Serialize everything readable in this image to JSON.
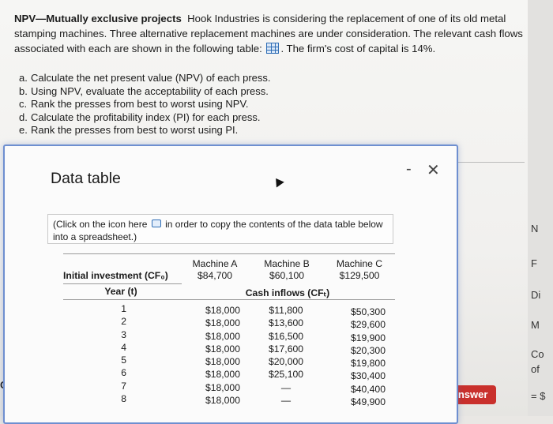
{
  "problem": {
    "title": "NPV—Mutually exclusive projects",
    "line1": "Hook Industries is considering the replacement of one of its old metal",
    "line2": "stamping machines. Three alternative replacement machines are under consideration. The relevant cash flows",
    "line3a": "associated with each are shown in the following table:",
    "line3b": ". The firm's cost of capital is 14%.",
    "tasks": [
      {
        "key": "a.",
        "text": "Calculate the net present value (NPV) of each press."
      },
      {
        "key": "b.",
        "text": "Using NPV, evaluate the acceptability of each press."
      },
      {
        "key": "c.",
        "text": "Rank the presses from best to worst using NPV."
      },
      {
        "key": "d.",
        "text": "Calculate the profitability index (PI) for each press."
      },
      {
        "key": "e.",
        "text": "Rank the presses from best to worst using PI."
      }
    ]
  },
  "modal": {
    "title": "Data table",
    "minimize": "-",
    "close": "✕",
    "note_a": "(Click on the icon here",
    "note_b": "in order to copy the contents of the data table below",
    "note_c": "into a spreadsheet.)"
  },
  "table": {
    "machines": [
      "Machine A",
      "Machine B",
      "Machine C"
    ],
    "initial_label": "Initial investment (CF₀)",
    "initial": [
      "$84,700",
      "$60,100",
      "$129,500"
    ],
    "year_label": "Year (t)",
    "cash_label": "Cash inflows (CFₜ)",
    "years": [
      "1",
      "2",
      "3",
      "4",
      "5",
      "6",
      "7",
      "8"
    ],
    "a": [
      "$18,000",
      "$18,000",
      "$18,000",
      "$18,000",
      "$18,000",
      "$18,000",
      "$18,000",
      "$18,000"
    ],
    "b": [
      "$11,800",
      "$13,600",
      "$16,500",
      "$17,600",
      "$20,000",
      "$25,100",
      "—",
      "—"
    ],
    "c": [
      "$50,300",
      "$29,600",
      "$19,900",
      "$20,300",
      "$19,800",
      "$30,400",
      "$40,400",
      "$49,900"
    ]
  },
  "side": {
    "edge": [
      "N",
      "F",
      "Di",
      "M",
      "Co",
      "of",
      "= $"
    ],
    "answer": "answer",
    "ge": "Ge"
  }
}
